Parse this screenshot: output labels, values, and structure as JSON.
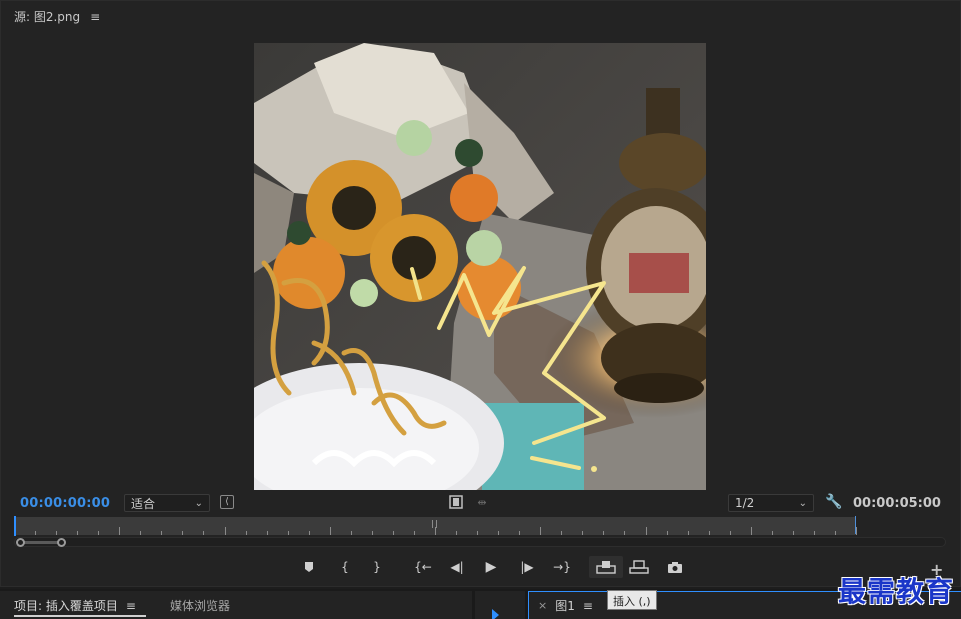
{
  "source_panel": {
    "tab_label": "源: 图2.png",
    "menu_icon": "≡"
  },
  "controls": {
    "timecode_in": "00:00:00:00",
    "timecode_out": "00:00:05:00",
    "fit_select": {
      "value": "适合"
    },
    "resolution_select": {
      "value": "1/2"
    },
    "playhead_position": 0
  },
  "transport": {
    "buttons": [
      {
        "name": "add-marker-icon",
        "glyph": "⬢"
      },
      {
        "name": "mark-in-icon",
        "glyph": "{"
      },
      {
        "name": "mark-out-icon",
        "glyph": "}"
      },
      {
        "name": "go-to-in-icon",
        "glyph": "{←"
      },
      {
        "name": "step-back-icon",
        "glyph": "◀|"
      },
      {
        "name": "play-icon",
        "glyph": "▶"
      },
      {
        "name": "step-forward-icon",
        "glyph": "|▶"
      },
      {
        "name": "go-to-out-icon",
        "glyph": "→}"
      },
      {
        "name": "insert-icon",
        "glyph": "⊞"
      },
      {
        "name": "overwrite-icon",
        "glyph": "⊟"
      },
      {
        "name": "export-frame-icon",
        "glyph": "📷"
      }
    ],
    "plus_label": "+"
  },
  "bottom_panels": {
    "project_tab": "项目: 插入覆盖项目",
    "media_browser_tab": "媒体浏览器",
    "sequence_tab": "图1",
    "close_label": "×"
  },
  "tooltip": "插入 (,)",
  "watermark": "最需教育",
  "colors": {
    "accent_blue": "#2f8fff",
    "timecode_blue": "#3a8ee6",
    "panel_bg": "#232323",
    "watermark_blue": "#1a36c8"
  }
}
